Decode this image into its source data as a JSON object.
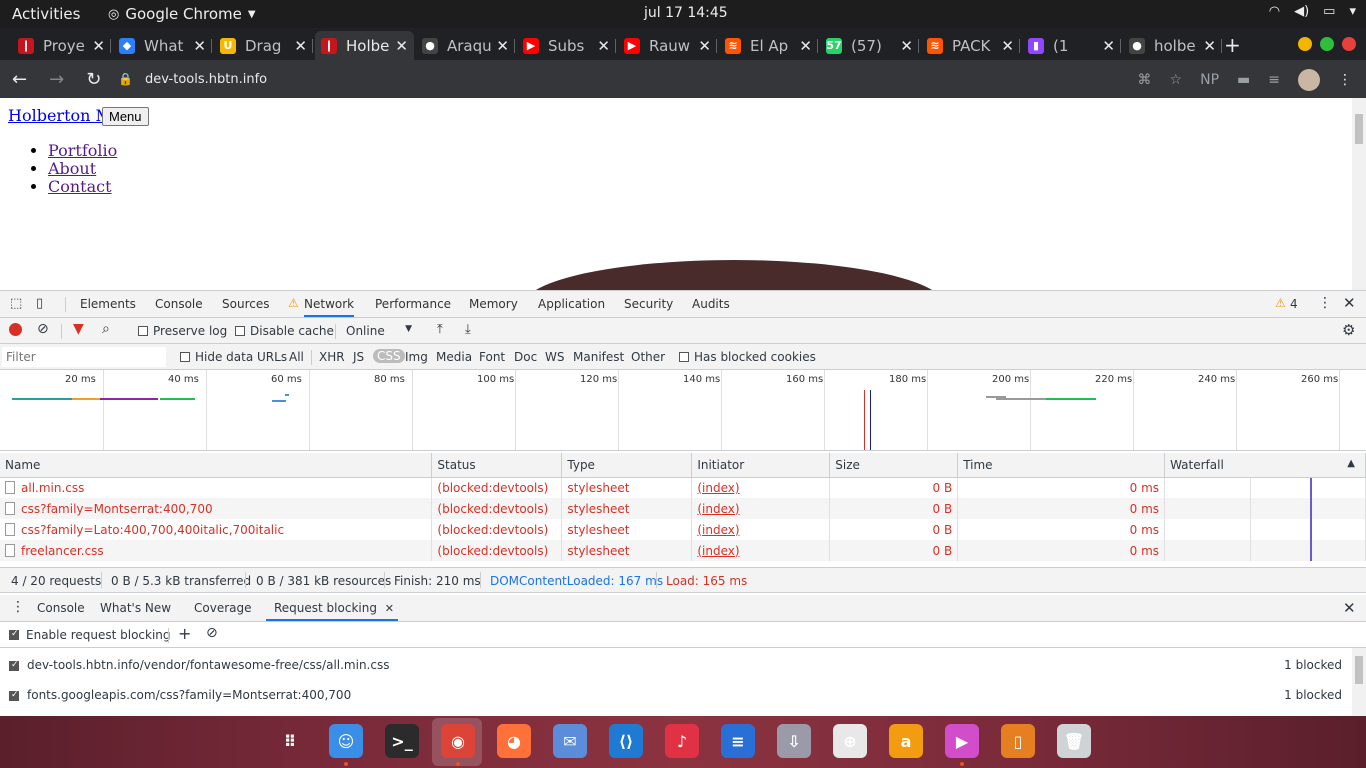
{
  "topbar": {
    "activities": "Activities",
    "app_name": "Google Chrome",
    "clock": "jul 17  14:45"
  },
  "tabs": [
    {
      "title": "Proye",
      "color": "#c4161c",
      "glyph": "❙"
    },
    {
      "title": "What",
      "color": "#2d7ff9",
      "glyph": "◆"
    },
    {
      "title": "Drag",
      "color": "#f5b800",
      "glyph": "U"
    },
    {
      "title": "Holbe",
      "color": "#c4161c",
      "glyph": "❙",
      "active": true
    },
    {
      "title": "Araqu",
      "color": "#444",
      "glyph": "●"
    },
    {
      "title": "Subs",
      "color": "#ff0000",
      "glyph": "▶"
    },
    {
      "title": "Rauw",
      "color": "#ff0000",
      "glyph": "▶"
    },
    {
      "title": "El Ap",
      "color": "#ff5500",
      "glyph": "≋"
    },
    {
      "title": "(57)",
      "color": "#25d366",
      "glyph": "57"
    },
    {
      "title": "PACK",
      "color": "#ff5500",
      "glyph": "≋"
    },
    {
      "title": "(1",
      "color": "#9146ff",
      "glyph": "▮"
    },
    {
      "title": "holbe",
      "color": "#444",
      "glyph": "●"
    }
  ],
  "toolbar": {
    "url": "dev-tools.hbtn.info",
    "np_label": "NP"
  },
  "page": {
    "brand": "Holberton Me",
    "menu_button": "Menu",
    "nav": [
      "Portfolio",
      "About",
      "Contact"
    ]
  },
  "devtools": {
    "panel_tabs": [
      "Elements",
      "Console",
      "Sources",
      "Network",
      "Performance",
      "Memory",
      "Application",
      "Security",
      "Audits"
    ],
    "active_panel": "Network",
    "warning_count": "4",
    "preserve_log": "Preserve log",
    "disable_cache": "Disable cache",
    "throttling": "Online",
    "filter_placeholder": "Filter",
    "hide_data_urls": "Hide data URLs",
    "type_filters": [
      "All",
      "XHR",
      "JS",
      "CSS",
      "Img",
      "Media",
      "Font",
      "Doc",
      "WS",
      "Manifest",
      "Other"
    ],
    "selected_type": "CSS",
    "has_blocked_cookies": "Has blocked cookies",
    "overview_ticks": [
      "20 ms",
      "40 ms",
      "60 ms",
      "80 ms",
      "100 ms",
      "120 ms",
      "140 ms",
      "160 ms",
      "180 ms",
      "200 ms",
      "220 ms",
      "240 ms",
      "260 ms"
    ],
    "columns": [
      "Name",
      "Status",
      "Type",
      "Initiator",
      "Size",
      "Time",
      "Waterfall"
    ],
    "requests": [
      {
        "name": "all.min.css",
        "status": "(blocked:devtools)",
        "type": "stylesheet",
        "initiator": "(index)",
        "size": "0 B",
        "time": "0 ms"
      },
      {
        "name": "css?family=Montserrat:400,700",
        "status": "(blocked:devtools)",
        "type": "stylesheet",
        "initiator": "(index)",
        "size": "0 B",
        "time": "0 ms"
      },
      {
        "name": "css?family=Lato:400,700,400italic,700italic",
        "status": "(blocked:devtools)",
        "type": "stylesheet",
        "initiator": "(index)",
        "size": "0 B",
        "time": "0 ms"
      },
      {
        "name": "freelancer.css",
        "status": "(blocked:devtools)",
        "type": "stylesheet",
        "initiator": "(index)",
        "size": "0 B",
        "time": "0 ms"
      }
    ],
    "summary": {
      "requests": "4 / 20 requests",
      "transferred": "0 B / 5.3 kB transferred",
      "resources": "0 B / 381 kB resources",
      "finish": "Finish: 210 ms",
      "dcl": "DOMContentLoaded: 167 ms",
      "load": "Load: 165 ms"
    },
    "drawer_tabs": [
      "Console",
      "What's New",
      "Coverage",
      "Request blocking"
    ],
    "active_drawer": "Request blocking",
    "enable_blocking": "Enable request blocking",
    "blocked_patterns": [
      {
        "pattern": "dev-tools.hbtn.info/vendor/fontawesome-free/css/all.min.css",
        "count": "1 blocked"
      },
      {
        "pattern": "fonts.googleapis.com/css?family=Montserrat:400,700",
        "count": "1 blocked"
      }
    ]
  },
  "dock": [
    {
      "name": "apps-grid-icon",
      "glyph": "⠿",
      "color": "transparent"
    },
    {
      "name": "finder-icon",
      "glyph": "☺",
      "color": "#3a8ee6"
    },
    {
      "name": "terminal-icon",
      "glyph": ">_",
      "color": "#2b2b2b"
    },
    {
      "name": "chrome-icon",
      "glyph": "◉",
      "color": "#db4437"
    },
    {
      "name": "firefox-icon",
      "glyph": "◕",
      "color": "#ff7139"
    },
    {
      "name": "thunderbird-icon",
      "glyph": "✉",
      "color": "#5c8ddb"
    },
    {
      "name": "vscode-icon",
      "glyph": "⟨⟩",
      "color": "#1f7ad3"
    },
    {
      "name": "music-icon",
      "glyph": "♪",
      "color": "#e03244"
    },
    {
      "name": "writer-icon",
      "glyph": "≡",
      "color": "#2a6fd6"
    },
    {
      "name": "download-icon",
      "glyph": "⇩",
      "color": "#9a9aa8"
    },
    {
      "name": "help-icon",
      "glyph": "⊕",
      "color": "#e8e8e8"
    },
    {
      "name": "amazon-icon",
      "glyph": "a",
      "color": "#f39c12"
    },
    {
      "name": "video-editor-icon",
      "glyph": "▶",
      "color": "#d24dc9"
    },
    {
      "name": "phone-icon",
      "glyph": "▯",
      "color": "#e67e22"
    },
    {
      "name": "trash-icon",
      "glyph": "🗑",
      "color": "#cfd3d6"
    }
  ]
}
